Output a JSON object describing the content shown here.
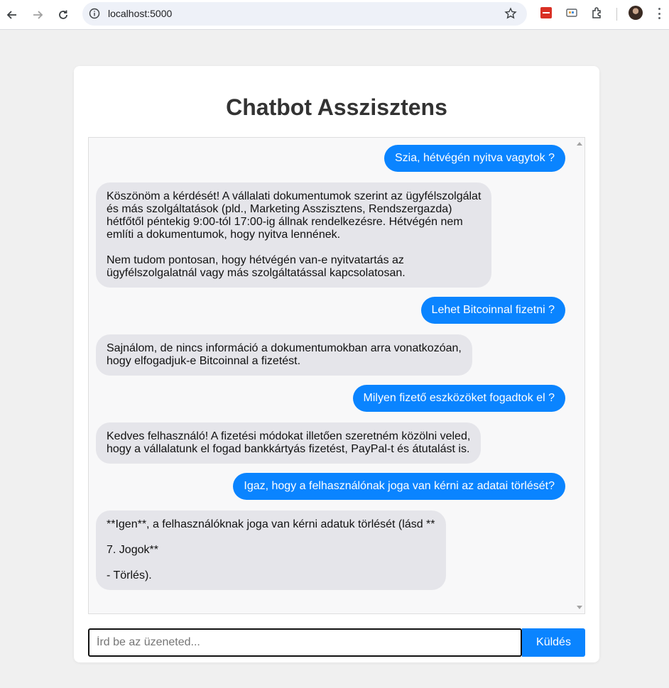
{
  "browser": {
    "url": "localhost:5000"
  },
  "page": {
    "title": "Chatbot Asszisztens"
  },
  "messages": [
    {
      "role": "user",
      "text": "Szia, hétvégén nyitva vagytok ?"
    },
    {
      "role": "bot",
      "text": "Köszönöm a kérdését! A vállalati dokumentumok szerint az ügyfélszolgálat\nés más szolgáltatások (pld., Marketing Asszisztens, Rendszergazda)\nhétfőtől péntekig 9:00-tól 17:00-ig állnak rendelkezésre. Hétvégén nem\nemlíti a dokumentumok, hogy nyitva lennének.\n\nNem tudom pontosan, hogy hétvégén van-e nyitvatartás az\nügyfélszolgalatnál vagy más szolgáltatással kapcsolatosan."
    },
    {
      "role": "user",
      "text": "Lehet Bitcoinnal fizetni ?"
    },
    {
      "role": "bot",
      "text": "Sajnálom, de nincs információ a dokumentumokban arra vonatkozóan,\nhogy elfogadjuk-e Bitcoinnal a fizetést."
    },
    {
      "role": "user",
      "text": "Milyen fizető eszközöket fogadtok el ?"
    },
    {
      "role": "bot",
      "text": "Kedves felhasználó! A fizetési módokat illetően szeretném közölni veled,\nhogy a vállalatunk el fogad bankkártyás fizetést, PayPal-t és átutalást is."
    },
    {
      "role": "user",
      "text": "Igaz, hogy a felhasználónak joga van kérni az adatai törlését?"
    },
    {
      "role": "bot",
      "text": "**Igen**, a felhasználóknak joga van kérni adatuk törlését (lásd **\n\n7. Jogok**\n\n- Törlés)."
    }
  ],
  "composer": {
    "placeholder": "Írd be az üzeneted...",
    "send_label": "Küldés"
  },
  "colors": {
    "user_bubble": "#0a84ff",
    "bot_bubble": "#e5e5ea",
    "send_button": "#0a84ff"
  }
}
